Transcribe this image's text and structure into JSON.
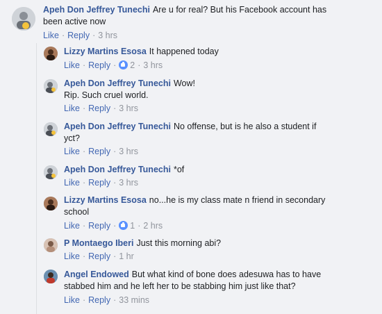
{
  "comments": [
    {
      "name": "Apeh Don Jeffrey Tunechi",
      "text_line1": "Are u for real? But his Facebook account has",
      "text_line2": "been active now",
      "like": "Like",
      "reply": "Reply",
      "time": "3 hrs"
    }
  ],
  "replies": [
    {
      "name": "Lizzy Martins Esosa",
      "text_line1": "It happened today",
      "text_line2": "",
      "like": "Like",
      "reply": "Reply",
      "reactions": "2",
      "time": "3 hrs"
    },
    {
      "name": "Apeh Don Jeffrey Tunechi",
      "text_line1": "Wow!",
      "text_line2": "Rip. Such cruel world.",
      "like": "Like",
      "reply": "Reply",
      "reactions": "",
      "time": "3 hrs"
    },
    {
      "name": "Apeh Don Jeffrey Tunechi",
      "text_line1": "No offense, but is he also a student if",
      "text_line2": "yct?",
      "like": "Like",
      "reply": "Reply",
      "reactions": "",
      "time": "3 hrs"
    },
    {
      "name": "Apeh Don Jeffrey Tunechi",
      "text_line1": "*of",
      "text_line2": "",
      "like": "Like",
      "reply": "Reply",
      "reactions": "",
      "time": "3 hrs"
    },
    {
      "name": "Lizzy Martins Esosa",
      "text_line1": "no...he is my class mate n friend in secondary",
      "text_line2": "school",
      "like": "Like",
      "reply": "Reply",
      "reactions": "1",
      "time": "2 hrs"
    },
    {
      "name": "P Montaego Iberi",
      "text_line1": "Just this morning abi?",
      "text_line2": "",
      "like": "Like",
      "reply": "Reply",
      "reactions": "",
      "time": "1 hr"
    },
    {
      "name": "Angel Endowed",
      "text_line1": "But what kind of bone does adesuwa has to have",
      "text_line2": "stabbed him and he left her to be stabbing him just like that?",
      "like": "Like",
      "reply": "Reply",
      "reactions": "",
      "time": "33 mins"
    }
  ],
  "colors": {
    "background": "#f1f2f5",
    "name": "#365899",
    "link": "#4267b2",
    "meta": "#90949c",
    "reaction": "#5890ff"
  }
}
